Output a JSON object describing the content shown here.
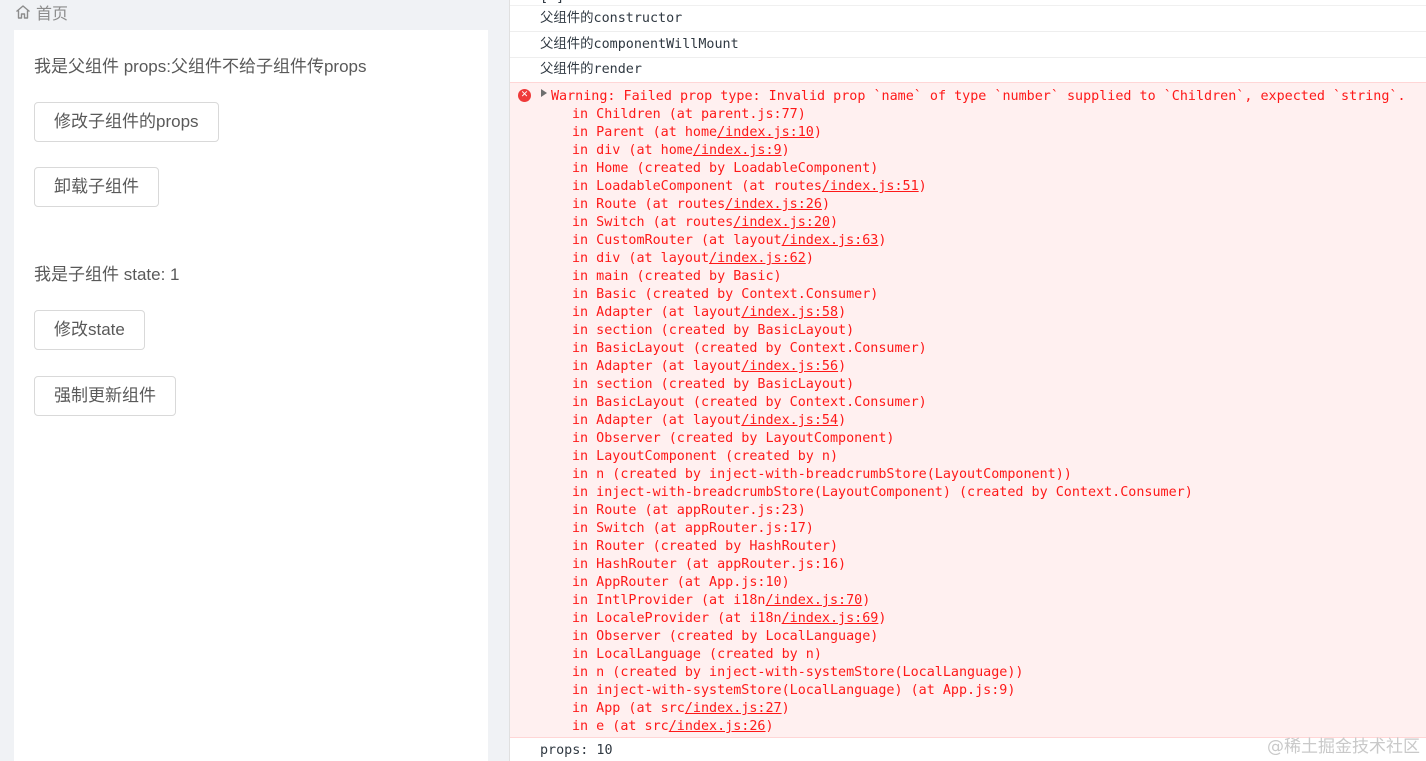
{
  "app": {
    "breadcrumb": {
      "label": "首页",
      "icon": "home-icon"
    },
    "parent_text": "我是父组件 props:父组件不给子组件传props",
    "buttons": {
      "modify_child_props": "修改子组件的props",
      "unmount_child": "卸载子组件",
      "modify_state": "修改state",
      "force_update": "强制更新组件"
    },
    "child_text": "我是子组件 state: 1"
  },
  "console": {
    "partial_line": "[ ] ",
    "logs": [
      "父组件的constructor",
      "父组件的componentWillMount",
      "父组件的render"
    ],
    "error": {
      "icon": "error-icon",
      "message": "Warning: Failed prop type: Invalid prop `name` of type `number` supplied to `Children`, expected `string`.",
      "stack": [
        {
          "text": "in Children (at parent.js:77)",
          "link": ""
        },
        {
          "text": "in Parent (at home",
          "link": "/index.js:10",
          "suffix": ")"
        },
        {
          "text": "in div (at home",
          "link": "/index.js:9",
          "suffix": ")"
        },
        {
          "text": "in Home (created by LoadableComponent)",
          "link": ""
        },
        {
          "text": "in LoadableComponent (at routes",
          "link": "/index.js:51",
          "suffix": ")"
        },
        {
          "text": "in Route (at routes",
          "link": "/index.js:26",
          "suffix": ")"
        },
        {
          "text": "in Switch (at routes",
          "link": "/index.js:20",
          "suffix": ")"
        },
        {
          "text": "in CustomRouter (at layout",
          "link": "/index.js:63",
          "suffix": ")"
        },
        {
          "text": "in div (at layout",
          "link": "/index.js:62",
          "suffix": ")"
        },
        {
          "text": "in main (created by Basic)",
          "link": ""
        },
        {
          "text": "in Basic (created by Context.Consumer)",
          "link": ""
        },
        {
          "text": "in Adapter (at layout",
          "link": "/index.js:58",
          "suffix": ")"
        },
        {
          "text": "in section (created by BasicLayout)",
          "link": ""
        },
        {
          "text": "in BasicLayout (created by Context.Consumer)",
          "link": ""
        },
        {
          "text": "in Adapter (at layout",
          "link": "/index.js:56",
          "suffix": ")"
        },
        {
          "text": "in section (created by BasicLayout)",
          "link": ""
        },
        {
          "text": "in BasicLayout (created by Context.Consumer)",
          "link": ""
        },
        {
          "text": "in Adapter (at layout",
          "link": "/index.js:54",
          "suffix": ")"
        },
        {
          "text": "in Observer (created by LayoutComponent)",
          "link": ""
        },
        {
          "text": "in LayoutComponent (created by n)",
          "link": ""
        },
        {
          "text": "in n (created by inject-with-breadcrumbStore(LayoutComponent))",
          "link": ""
        },
        {
          "text": "in inject-with-breadcrumbStore(LayoutComponent) (created by Context.Consumer)",
          "link": ""
        },
        {
          "text": "in Route (at appRouter.js:23)",
          "link": ""
        },
        {
          "text": "in Switch (at appRouter.js:17)",
          "link": ""
        },
        {
          "text": "in Router (created by HashRouter)",
          "link": ""
        },
        {
          "text": "in HashRouter (at appRouter.js:16)",
          "link": ""
        },
        {
          "text": "in AppRouter (at App.js:10)",
          "link": ""
        },
        {
          "text": "in IntlProvider (at i18n",
          "link": "/index.js:70",
          "suffix": ")"
        },
        {
          "text": "in LocaleProvider (at i18n",
          "link": "/index.js:69",
          "suffix": ")"
        },
        {
          "text": "in Observer (created by LocalLanguage)",
          "link": ""
        },
        {
          "text": "in LocalLanguage (created by n)",
          "link": ""
        },
        {
          "text": "in n (created by inject-with-systemStore(LocalLanguage))",
          "link": ""
        },
        {
          "text": "in inject-with-systemStore(LocalLanguage) (at App.js:9)",
          "link": ""
        },
        {
          "text": "in App (at src",
          "link": "/index.js:27",
          "suffix": ")"
        },
        {
          "text": "in e (at src",
          "link": "/index.js:26",
          "suffix": ")"
        }
      ]
    },
    "props_line": "props: 10"
  },
  "watermark": "@稀土掘金技术社区",
  "colors": {
    "error_text": "#fe1919",
    "error_background": "#fff0f0",
    "page_background": "#f0f2f5"
  }
}
